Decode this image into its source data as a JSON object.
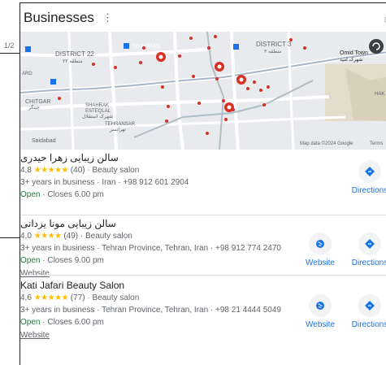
{
  "page_indicator": "1/2",
  "panel": {
    "title": "Businesses",
    "menu_icon": "more-vert-icon",
    "right_icon": "info-icon"
  },
  "map": {
    "labels": {
      "district22": "DISTRICT 22",
      "district22_fa": "منطقه ۲۲",
      "district3": "DISTRICT 3",
      "district3_fa": "منطقه ۳",
      "shahran": "SHAHRAN",
      "shahran_fa": "شهران",
      "omid_town": "Omid Town",
      "omid_town_fa": "شهرک امید",
      "chitgar": "CHITGAR",
      "chitgar_fa": "چیتگر",
      "shahrak": "SHAHRAK",
      "ekbatan": "ESTEQLAL",
      "shahrak_fa": "شهرک استقلال",
      "tehransar": "TEHRANSAR",
      "tehransar_fa": "تهرانسر",
      "saidabad": "Saidabad",
      "hak": "HAK",
      "ard": "ARD",
      "attribution": "Map data ©2024 Google",
      "terms": "Terms"
    }
  },
  "businesses": [
    {
      "name": "سالن زیبایی زهرا حیدری",
      "rating": "4,8",
      "stars": "★★★★★",
      "reviews": "(40)",
      "category": "Beauty salon",
      "details": "3+ years in business · Iran · +98 912 601 2904",
      "open": "Open",
      "hours": "· Closes 6.00 pm",
      "website": null,
      "actions": [
        "Directions"
      ]
    },
    {
      "name": "سالن زیبایی مونا یزدانی",
      "rating": "4,0",
      "stars": "★★★★",
      "reviews": "(49)",
      "category": "Beauty salon",
      "details": "3+ years in business · Tehran Province, Tehran, Iran · +98 912 774 2470",
      "open": "Open",
      "hours": "· Closes 9.00 pm",
      "website": "Website",
      "actions": [
        "Website",
        "Directions"
      ]
    },
    {
      "name": "Kati Jafari Beauty Salon",
      "rating": "4,6",
      "stars": "★★★★★",
      "reviews": "(77)",
      "category": "Beauty salon",
      "details": "3+ years in business · Tehran Province, Tehran, Iran · +98 21 4444 5049",
      "open": "Open",
      "hours": "· Closes 6.00 pm",
      "website": "Website",
      "actions": [
        "Website",
        "Directions"
      ]
    }
  ],
  "colors": {
    "accent": "#1a73e8",
    "open": "#188038",
    "star": "#fbbc04",
    "pin": "#d93025"
  }
}
